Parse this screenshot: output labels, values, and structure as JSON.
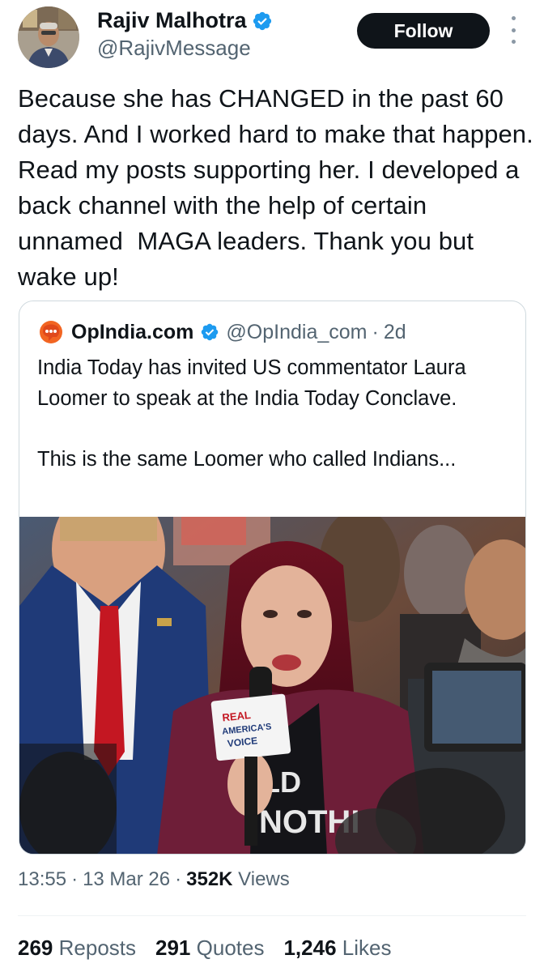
{
  "tweet": {
    "author": {
      "name": "Rajiv Malhotra",
      "handle": "@RajivMessage",
      "verified": true
    },
    "follow_label": "Follow",
    "text": "Because she has CHANGED in the past 60 days. And I worked hard to make that happen. Read my posts supporting her. I developed a back channel with the help of certain unnamed  MAGA leaders. Thank you but wake up!",
    "quoted": {
      "name": "OpIndia.com",
      "handle": "@OpIndia_com",
      "dot": "·",
      "time": "2d",
      "verified": true,
      "text": "India Today has invited US commentator Laura Loomer to speak at the India Today Conclave.\n\nThis is the same Loomer who called Indians...",
      "image": {
        "microphone_text_1": "REAL",
        "microphone_text_2": "AMERICA'S",
        "microphone_text_3": "VOICE",
        "shirt_text_1": "LD",
        "shirt_text_2": "NOTHI"
      }
    },
    "meta": {
      "time": "13:55",
      "sep1": "·",
      "date": "13 Mar 26",
      "sep2": "·",
      "views_count": "352K",
      "views_label": "Views"
    },
    "stats": {
      "reposts_count": "269",
      "reposts_label": "Reposts",
      "quotes_count": "291",
      "quotes_label": "Quotes",
      "likes_count": "1,246",
      "likes_label": "Likes"
    }
  },
  "colors": {
    "text_primary": "#0f1419",
    "text_secondary": "#536471",
    "verified_blue": "#1d9bf0",
    "follow_bg": "#0f1419",
    "border": "#cfd9de",
    "opindia_orange": "#f26522"
  },
  "icons": [
    "verified-badge-icon",
    "more-options-icon",
    "opindia-logo-icon"
  ]
}
